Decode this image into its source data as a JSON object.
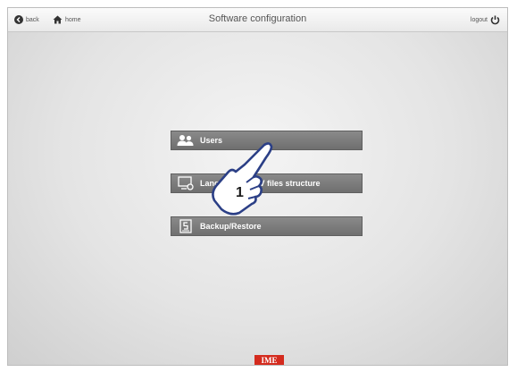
{
  "header": {
    "title": "Software configuration",
    "back_label": "back",
    "home_label": "home",
    "logout_label": "logout"
  },
  "menu": {
    "items": [
      {
        "label": "Users",
        "icon": "users-icon"
      },
      {
        "label": "Language & CSV files structure",
        "icon": "monitor-settings-icon"
      },
      {
        "label": "Backup/Restore",
        "icon": "backup-icon"
      }
    ]
  },
  "callout": {
    "number": "1"
  },
  "footer": {
    "logo": "IME"
  },
  "colors": {
    "button_bg": "#7a7a7a",
    "logo_red": "#d42b1e"
  }
}
